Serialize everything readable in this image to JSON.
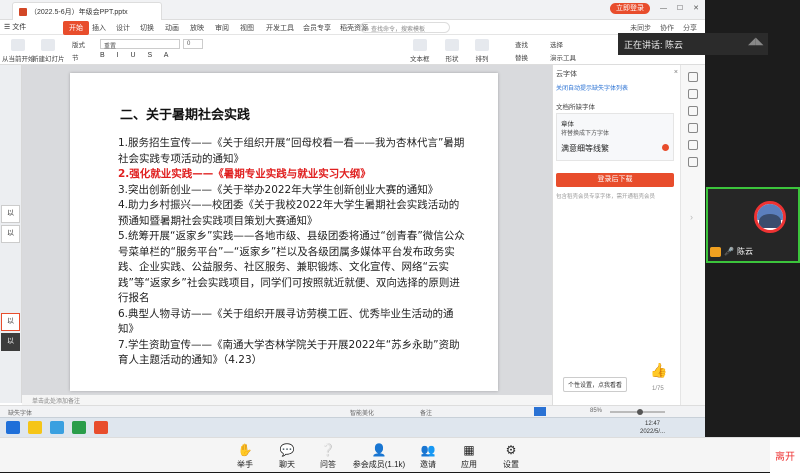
{
  "wps": {
    "doc_tab": "（2022.5-6月）年级会PPT.pptx",
    "login_button": "立即登录",
    "menu_file": "☰ 文件",
    "menu_start": "开始",
    "menu_tabs": [
      "插入",
      "设计",
      "切换",
      "动画",
      "放映",
      "审阅",
      "视图",
      "开发工具",
      "会员专享",
      "稻壳资源"
    ],
    "search_placeholder": "查找命令，搜索模板",
    "menu_right": [
      "未同步",
      "协作",
      "分享"
    ],
    "toolbar": {
      "from_current": "从当前开始",
      "new_slide": "新建幻灯片",
      "layout": "版式",
      "section": "节",
      "reset": "重置",
      "font_size": "0",
      "textbox": "文本框",
      "shape": "形状",
      "arrange": "排列",
      "find": "查找",
      "select": "选择",
      "replace": "替换",
      "presentation_tools": "演示工具"
    },
    "thumbs": [
      "以",
      "以",
      "以",
      "以"
    ]
  },
  "slide": {
    "title": "二、关于暑期社会实践",
    "items": [
      {
        "prefix": "1.服务招生宣传——《关于组织开展“回母校看一看——我为杏林代言”暑期社会实践专项活动的通知》",
        "red": ""
      },
      {
        "prefix": "",
        "red": "2.强化就业实践——《暑期专业实践与就业实习大纲》"
      },
      {
        "prefix": "3.突出创新创业——《关于举办2022年大学生创新创业大赛的通知》",
        "red": ""
      },
      {
        "prefix": "4.助力乡村振兴——校团委《关于我校2022年大学生暑期社会实践活动的预通知暨暑期社会实践项目策划大赛通知》",
        "red": ""
      },
      {
        "prefix": "5.统筹开展“返家乡”实践——各地市级、县级团委将通过“创青春”微信公众号菜单栏的“服务平台”—“返家乡”栏以及各级团属多媒体平台发布政务实践、企业实践、公益服务、社区服务、兼职锻炼、文化宣传、网络“云实践”等“返家乡”社会实践项目，同学们可按照就近就便、双向选择的原则进行报名",
        "red": ""
      },
      {
        "prefix": "6.典型人物寻访——《关于组织开展寻访劳模工匠、优秀毕业生活动的通知》",
        "red": ""
      },
      {
        "prefix": "7.学生资助宣传——《南通大学杏林学院关于开展2022年“苏乡永助”资助育人主题活动的通知》（4.23）",
        "red": ""
      }
    ],
    "notes_placeholder": "单击此处添加备注"
  },
  "font_pane": {
    "title": "云字体",
    "close": "×",
    "link": "关闭自动提示缺失字体列表",
    "missing_label": "文档所缺字体",
    "font_name": "章体",
    "font_hint": "将替换成下方字体",
    "sample": "满意细等线繁",
    "download_button": "登录后下载",
    "note": "包含稻壳会员专享字体，需开通稻壳会员",
    "tooltip": "个性设置，点我看看",
    "page_count": "1/75"
  },
  "status": {
    "slide_info": "缺失字体",
    "smart_beautify": "智能美化",
    "notes": "备注",
    "zoom": "85%"
  },
  "clock": {
    "time": "12:47",
    "date": "2022/5/..."
  },
  "meeting": {
    "speaking": "正在讲话: 陈云",
    "participant_name": "陈云",
    "controls": [
      {
        "label": "举手",
        "icon": "hand-icon"
      },
      {
        "label": "聊天",
        "icon": "chat-icon"
      },
      {
        "label": "问答",
        "icon": "qa-icon"
      },
      {
        "label": "参会成员(1.1k)",
        "icon": "members-icon"
      },
      {
        "label": "邀请",
        "icon": "invite-icon"
      },
      {
        "label": "应用",
        "icon": "apps-icon"
      },
      {
        "label": "设置",
        "icon": "settings-icon"
      }
    ],
    "leave": "离开"
  }
}
